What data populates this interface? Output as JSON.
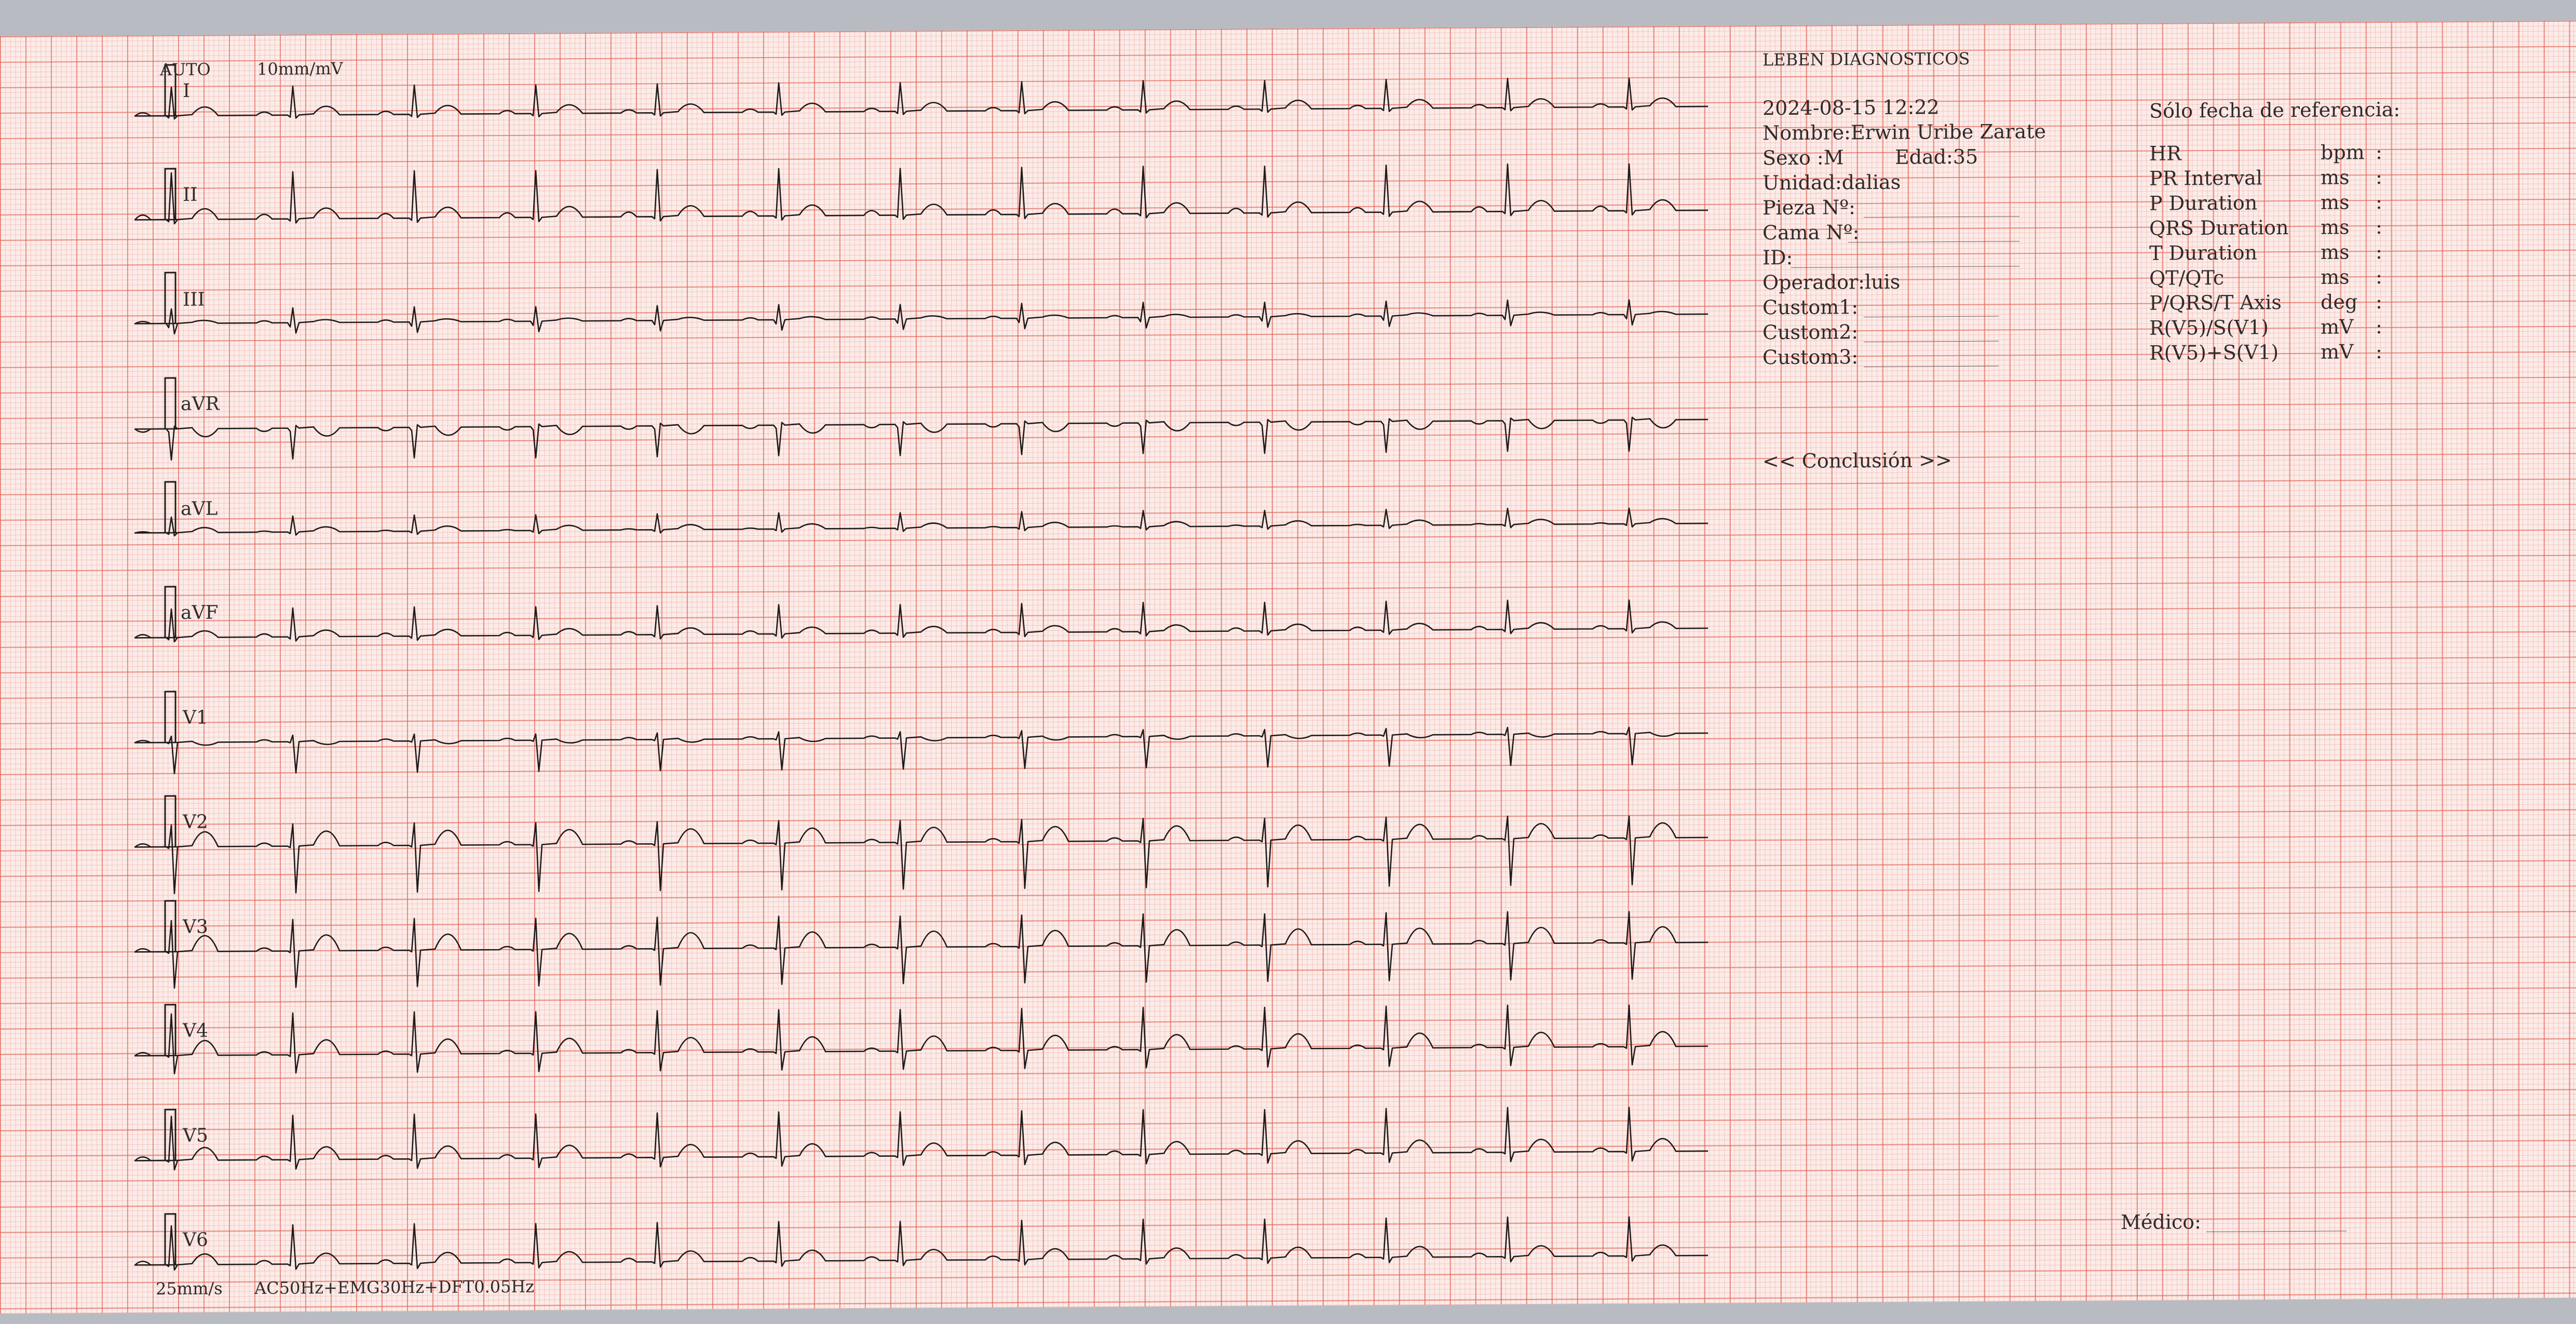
{
  "header": {
    "auto": "AUTO",
    "gain": "10mm/mV"
  },
  "leads": [
    "I",
    "II",
    "III",
    "aVR",
    "aVL",
    "aVF",
    "V1",
    "V2",
    "V3",
    "V4",
    "V5",
    "V6"
  ],
  "footer": {
    "speed": "25mm/s",
    "filters": "AC50Hz+EMG30Hz+DFT0.05Hz"
  },
  "patient": {
    "clinic": "LEBEN DIAGNOSTICOS",
    "datetime": "2024-08-15 12:22",
    "name": "Nombre:Erwin Uribe Zarate",
    "sex": "Sexo :M",
    "age": "Edad:35",
    "unit": "Unidad:dalias",
    "piece": "Pieza Nº:",
    "bed": "Cama Nº:",
    "id": "ID:",
    "operator": "Operador:luis",
    "custom1": "Custom1:",
    "custom2": "Custom2:",
    "custom3": "Custom3:"
  },
  "reference": {
    "title": "Sólo fecha de referencia:",
    "rows": [
      {
        "label": "HR",
        "unit": "bpm",
        "sep": ":"
      },
      {
        "label": "PR Interval",
        "unit": "ms",
        "sep": ":"
      },
      {
        "label": "P Duration",
        "unit": "ms",
        "sep": ":"
      },
      {
        "label": "QRS Duration",
        "unit": "ms",
        "sep": ":"
      },
      {
        "label": "T Duration",
        "unit": "ms",
        "sep": ":"
      },
      {
        "label": "QT/QTc",
        "unit": "ms",
        "sep": ":"
      },
      {
        "label": "P/QRS/T Axis",
        "unit": "deg",
        "sep": ":"
      },
      {
        "label": "R(V5)/S(V1)",
        "unit": "mV",
        "sep": ":"
      },
      {
        "label": "R(V5)+S(V1)",
        "unit": "mV",
        "sep": ":"
      }
    ]
  },
  "conclusion": "<< Conclusión >>",
  "doctor": "Médico:"
}
